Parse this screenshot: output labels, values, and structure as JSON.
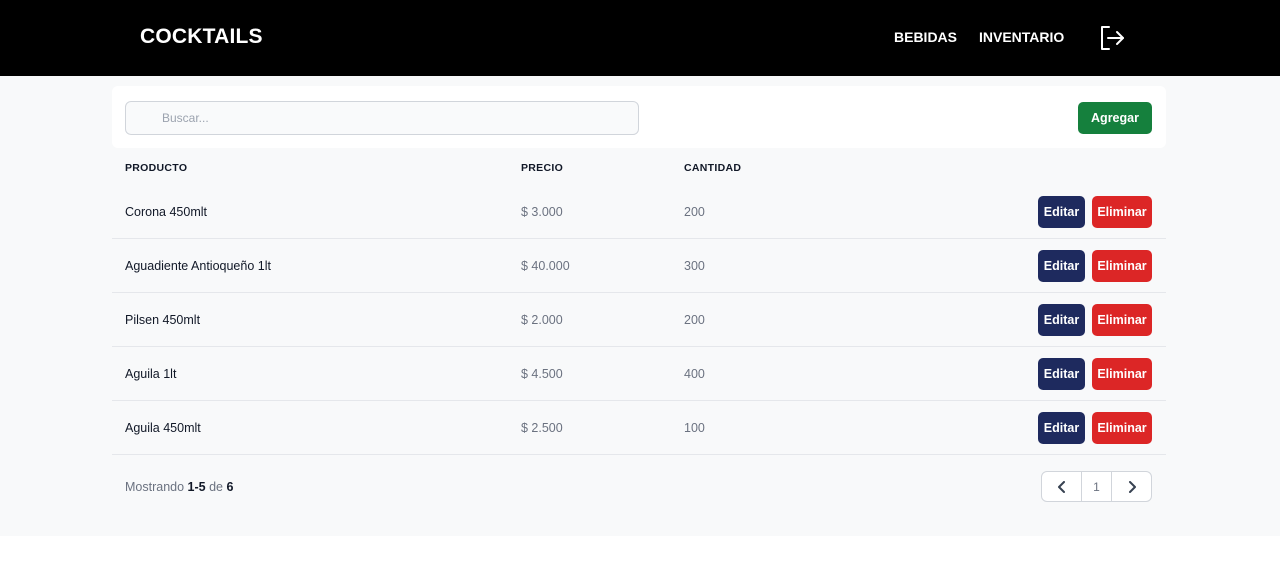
{
  "header": {
    "brand": "COCKTAILS",
    "nav": [
      {
        "label": "BEBIDAS"
      },
      {
        "label": "INVENTARIO"
      }
    ],
    "logout_icon": "logout-icon"
  },
  "toolbar": {
    "search_placeholder": "Buscar...",
    "search_value": "",
    "add_label": "Agregar"
  },
  "table": {
    "columns": [
      "PRODUCTO",
      "PRECIO",
      "CANTIDAD"
    ],
    "rows": [
      {
        "producto": "Corona 450mlt",
        "precio": "$ 3.000",
        "cantidad": "200",
        "edit": "Editar",
        "delete": "Eliminar"
      },
      {
        "producto": "Aguadiente Antioqueño 1lt",
        "precio": "$ 40.000",
        "cantidad": "300",
        "edit": "Editar",
        "delete": "Eliminar"
      },
      {
        "producto": "Pilsen 450mlt",
        "precio": "$ 2.000",
        "cantidad": "200",
        "edit": "Editar",
        "delete": "Eliminar"
      },
      {
        "producto": "Aguila 1lt",
        "precio": "$ 4.500",
        "cantidad": "400",
        "edit": "Editar",
        "delete": "Eliminar"
      },
      {
        "producto": "Aguila 450mlt",
        "precio": "$ 2.500",
        "cantidad": "100",
        "edit": "Editar",
        "delete": "Eliminar"
      }
    ]
  },
  "pagination": {
    "showing_prefix": "Mostrando",
    "range": "1-5",
    "of_label": "de",
    "total": "6",
    "current_page": "1",
    "prev_icon": "chevron-left-icon",
    "next_icon": "chevron-right-icon"
  },
  "colors": {
    "header_bg": "#000000",
    "add_button": "#15803d",
    "edit_button": "#1e2a5e",
    "delete_button": "#dc2626"
  }
}
